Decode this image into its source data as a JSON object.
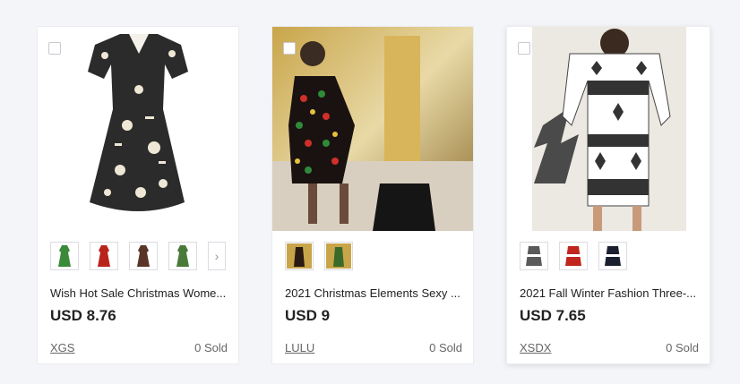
{
  "products": [
    {
      "title": "Wish Hot Sale Christmas Wome...",
      "price": "USD 8.76",
      "shop": "XGS",
      "sold": "0 Sold",
      "thumbnail_colors": [
        "#3a8a3a",
        "#b8241c",
        "#5a3428",
        "#4a7a3a",
        "#e6e6e6"
      ]
    },
    {
      "title": "2021 Christmas Elements Sexy ...",
      "price": "USD 9",
      "shop": "LULU",
      "sold": "0 Sold",
      "thumbnail_colors": [
        "#2a1a12",
        "#3a6a2a"
      ]
    },
    {
      "title": "2021 Fall Winter Fashion Three-...",
      "price": "USD 7.65",
      "shop": "XSDX",
      "sold": "0 Sold",
      "thumbnail_colors": [
        "#5a5a5a",
        "#c0261e",
        "#1a2030"
      ]
    }
  ],
  "colors": {
    "page_bg": "#f4f5f8",
    "card_bg": "#ffffff",
    "text_primary": "#222222",
    "text_secondary": "#666666"
  }
}
